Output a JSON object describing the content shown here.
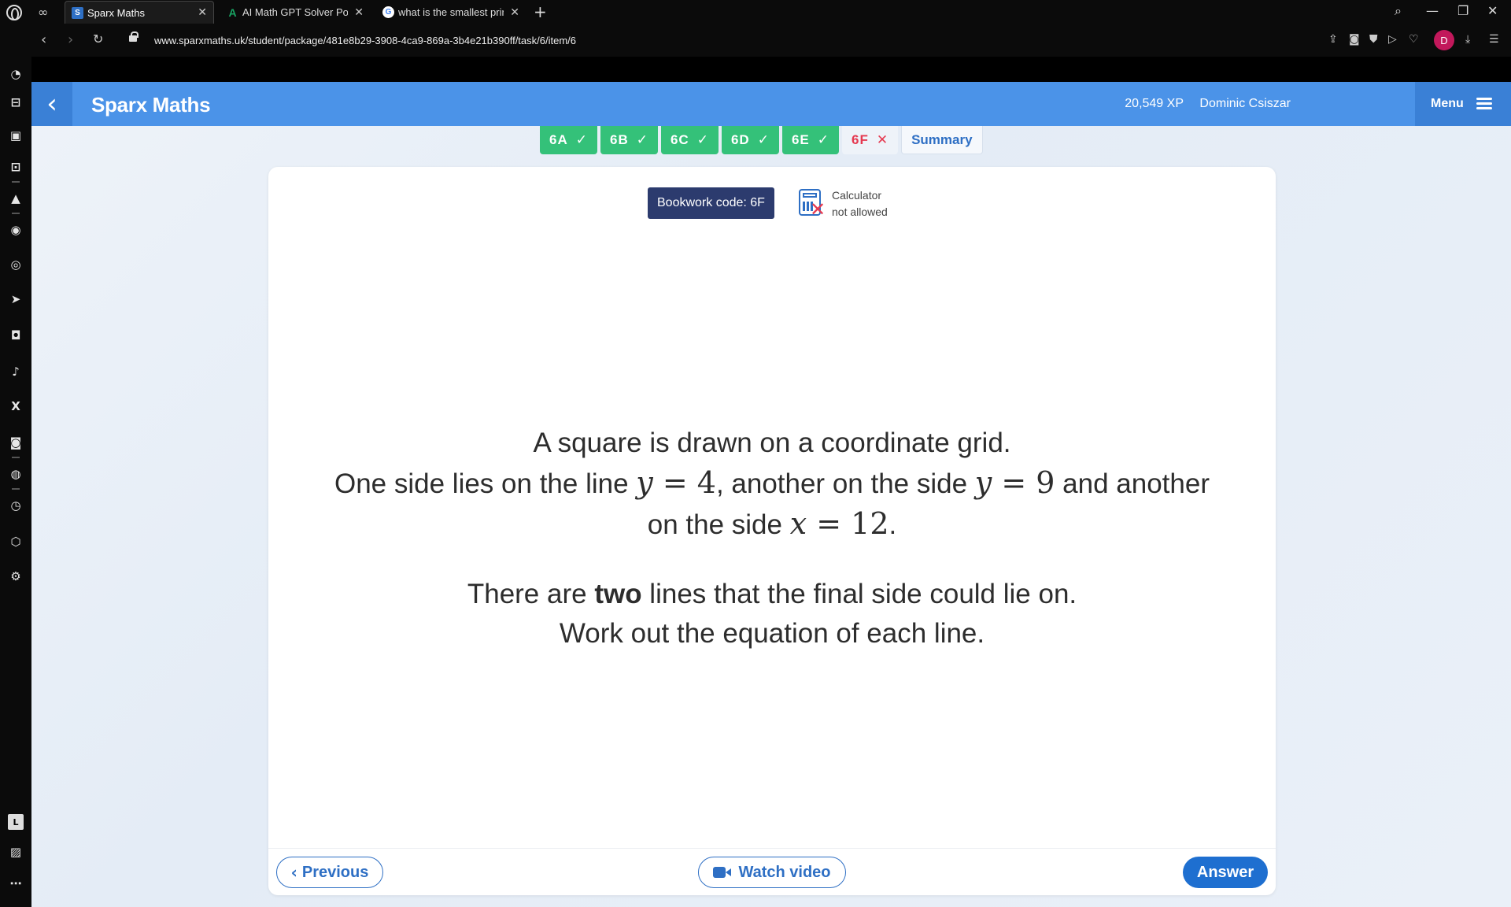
{
  "browser": {
    "tabs": [
      {
        "title": "Sparx Maths",
        "favicon": "S",
        "favicon_color": "#2e6fc4",
        "active": true
      },
      {
        "title": "AI Math GPT Solver Powere",
        "favicon": "A",
        "favicon_color": "#19a463",
        "active": false
      },
      {
        "title": "what is the smallest prime",
        "favicon": "G",
        "favicon_color": "#4285f4",
        "active": false
      }
    ],
    "url": "www.sparxmaths.uk/student/package/481e8b29-3908-4ca9-869a-3b4e21b390ff/task/6/item/6",
    "profile_initial": "D"
  },
  "header": {
    "brand": "Sparx Maths",
    "xp": "20,549 XP",
    "user_name": "Dominic Csiszar",
    "menu_label": "Menu"
  },
  "task_tabs": [
    {
      "label": "6A",
      "status": "done"
    },
    {
      "label": "6B",
      "status": "done"
    },
    {
      "label": "6C",
      "status": "done"
    },
    {
      "label": "6D",
      "status": "done"
    },
    {
      "label": "6E",
      "status": "done"
    },
    {
      "label": "6F",
      "status": "incorrect"
    },
    {
      "label": "Summary",
      "status": "summary"
    }
  ],
  "card": {
    "bookwork": "Bookwork code: 6F",
    "calculator_line1": "Calculator",
    "calculator_line2": "not allowed"
  },
  "question": {
    "l1": "A square is drawn on a coordinate grid.",
    "l2a": "One side lies on the line ",
    "eq1_var": "y",
    "eq1_rest": " = 4",
    "l2b": ", another on the side ",
    "eq2_var": "y",
    "eq2_rest": " = 9",
    "l2c": " and another",
    "l3a": "on the side ",
    "eq3_var": "x",
    "eq3_rest": " = 12",
    "l3b": ".",
    "l4a": "There are ",
    "l4b": "two",
    "l4c": " lines that the final side could lie on.",
    "l5": "Work out the equation of each line."
  },
  "footer": {
    "previous": "Previous",
    "watch_video": "Watch video",
    "answer": "Answer"
  },
  "colors": {
    "header_blue": "#4b93e8",
    "done_green": "#34c179",
    "incorrect_red": "#e53950",
    "answer_blue": "#1e6fd0"
  }
}
